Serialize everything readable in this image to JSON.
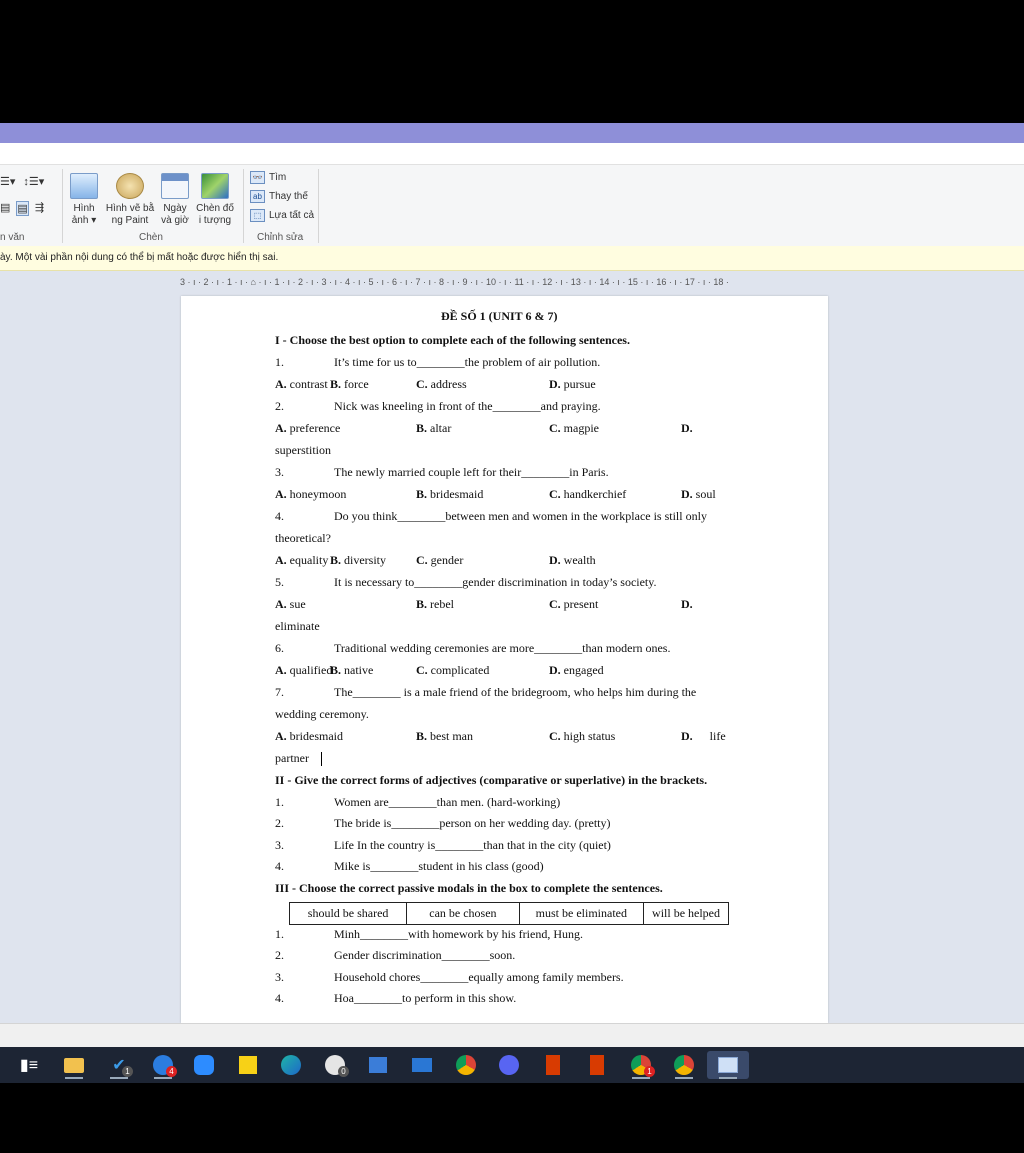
{
  "ribbon": {
    "para_group_label": "n văn",
    "insert_group_label": "Chèn",
    "insert_tools": [
      {
        "line1": "Hình",
        "line2": "ảnh ▾"
      },
      {
        "line1": "Hình vẽ bằ",
        "line2": "ng Paint"
      },
      {
        "line1": "Ngày",
        "line2": "và giờ"
      },
      {
        "line1": "Chèn đố",
        "line2": "i tượng"
      }
    ],
    "edit_group_label": "Chỉnh sửa",
    "edit_tools": {
      "find": "Tìm",
      "replace": "Thay thế",
      "select_all": "Lựa tất cả"
    }
  },
  "infobar": {
    "message": "ày. Một vài phần nội dung có thể bị mất hoặc được hiển thị sai."
  },
  "ruler": {
    "text": "3 · ı · 2 · ı · 1 · ı · ⌂ · ı · 1 · ı · 2 · ı · 3 · ı · 4 · ı · 5 · ı · 6 · ı · 7 · ı · 8 · ı · 9 · ı · 10 · ı · 11 · ı · 12 · ı · 13 · ı · 14 · ı · 15 · ı · 16 · ı · 17 · ı · 18 ·"
  },
  "doc": {
    "title": "ĐỀ SỐ 1 (UNIT 6 & 7)",
    "sec1": "I - Choose the best option to complete each of the following sentences.",
    "q1": {
      "n": "1.",
      "t": "It’s time for us to________the problem of air pollution."
    },
    "q1o": {
      "a": "contrast",
      "b": "force",
      "c": "address",
      "d": "pursue"
    },
    "q2": {
      "n": "2.",
      "t": "Nick was kneeling in front of the________and praying."
    },
    "q2o": {
      "a": "preference",
      "b": "altar",
      "c": "magpie",
      "d": "",
      "d_cont": "superstition"
    },
    "q3": {
      "n": "3.",
      "t": "The newly married couple left for their________in Paris."
    },
    "q3o": {
      "a": "honeymoon",
      "b": "bridesmaid",
      "c": "handkerchief",
      "d": "soul"
    },
    "q4": {
      "n": "4.",
      "t": "Do you think________between men and women in the workplace is still only",
      "t2": "theoretical?"
    },
    "q4o": {
      "a": "equality",
      "b": "diversity",
      "c": "gender",
      "d": "wealth"
    },
    "q5": {
      "n": "5.",
      "t": "It is necessary to________gender discrimination in today’s society."
    },
    "q5o": {
      "a": "sue",
      "b": "rebel",
      "c": "present",
      "d": "",
      "d_cont": "eliminate"
    },
    "q6": {
      "n": "6.",
      "t": "Traditional wedding ceremonies are more________than modern ones."
    },
    "q6o": {
      "a": "qualified",
      "b": "native",
      "c": "complicated",
      "d": "engaged"
    },
    "q7": {
      "n": "7.",
      "t": "The________ is a male friend of the bridegroom, who helps him during the",
      "t2": "wedding ceremony."
    },
    "q7o": {
      "a": "bridesmaid",
      "b": "best man",
      "c": "high status",
      "d": "life",
      "d_cont": "partner"
    },
    "sec2": "II - Give the correct forms of adjectives (comparative or superlative) in the brackets.",
    "s2": [
      {
        "n": "1.",
        "t": "Women are________than men. (hard-working)"
      },
      {
        "n": "2.",
        "t": "The bride is________person on her wedding day. (pretty)"
      },
      {
        "n": "3.",
        "t": "Life In the country is________than that in the city (quiet)"
      },
      {
        "n": "4.",
        "t": "Mike is________student in his class (good)"
      }
    ],
    "sec3": "III - Choose the correct passive modals in the box to complete the sentences.",
    "box": [
      "should be shared",
      "can be chosen",
      "must be eliminated",
      "will be helped"
    ],
    "s3": [
      {
        "n": "1.",
        "t": "Minh________with homework by his friend, Hung."
      },
      {
        "n": "2.",
        "t": "Gender discrimination________soon."
      },
      {
        "n": "3.",
        "t": "Household chores________equally among family members."
      },
      {
        "n": "4.",
        "t": "Hoa________to perform in this show."
      }
    ],
    "labels": {
      "a": "A.",
      "b": "B.",
      "c": "C.",
      "d": "D."
    }
  },
  "taskbar": {
    "badges": {
      "mail": "1",
      "zalo": "4",
      "clock": "0",
      "chrome": "1"
    }
  }
}
